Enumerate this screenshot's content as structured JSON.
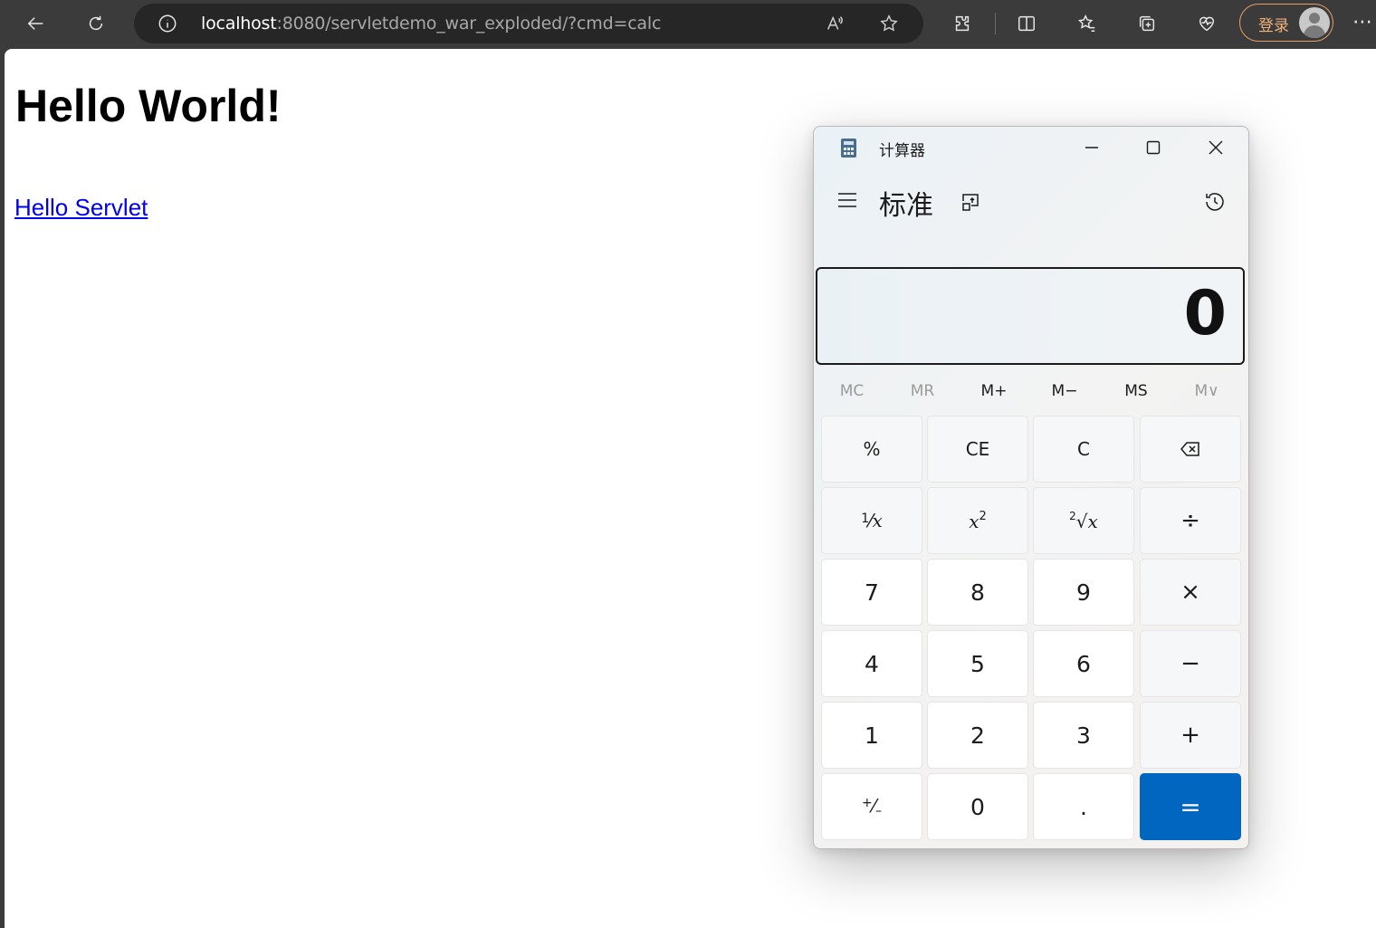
{
  "browser": {
    "url_host": "localhost",
    "url_rest": ":8080/servletdemo_war_exploded/?cmd=calc",
    "login_label": "登录",
    "more_label": "⋯"
  },
  "page": {
    "heading": "Hello World!",
    "link": "Hello Servlet"
  },
  "calculator": {
    "window_title": "计算器",
    "mode": "标准",
    "display_value": "0",
    "memory": [
      "MC",
      "MR",
      "M+",
      "M−",
      "MS",
      "M∨"
    ],
    "keys": {
      "percent": "%",
      "ce": "CE",
      "c": "C",
      "divide": "÷",
      "seven": "7",
      "eight": "8",
      "nine": "9",
      "multiply": "×",
      "four": "4",
      "five": "5",
      "six": "6",
      "minus": "−",
      "one": "1",
      "two": "2",
      "three": "3",
      "plus": "+",
      "zero": "0",
      "decimal": ".",
      "equals": "="
    },
    "accent_color": "#0066c0"
  }
}
